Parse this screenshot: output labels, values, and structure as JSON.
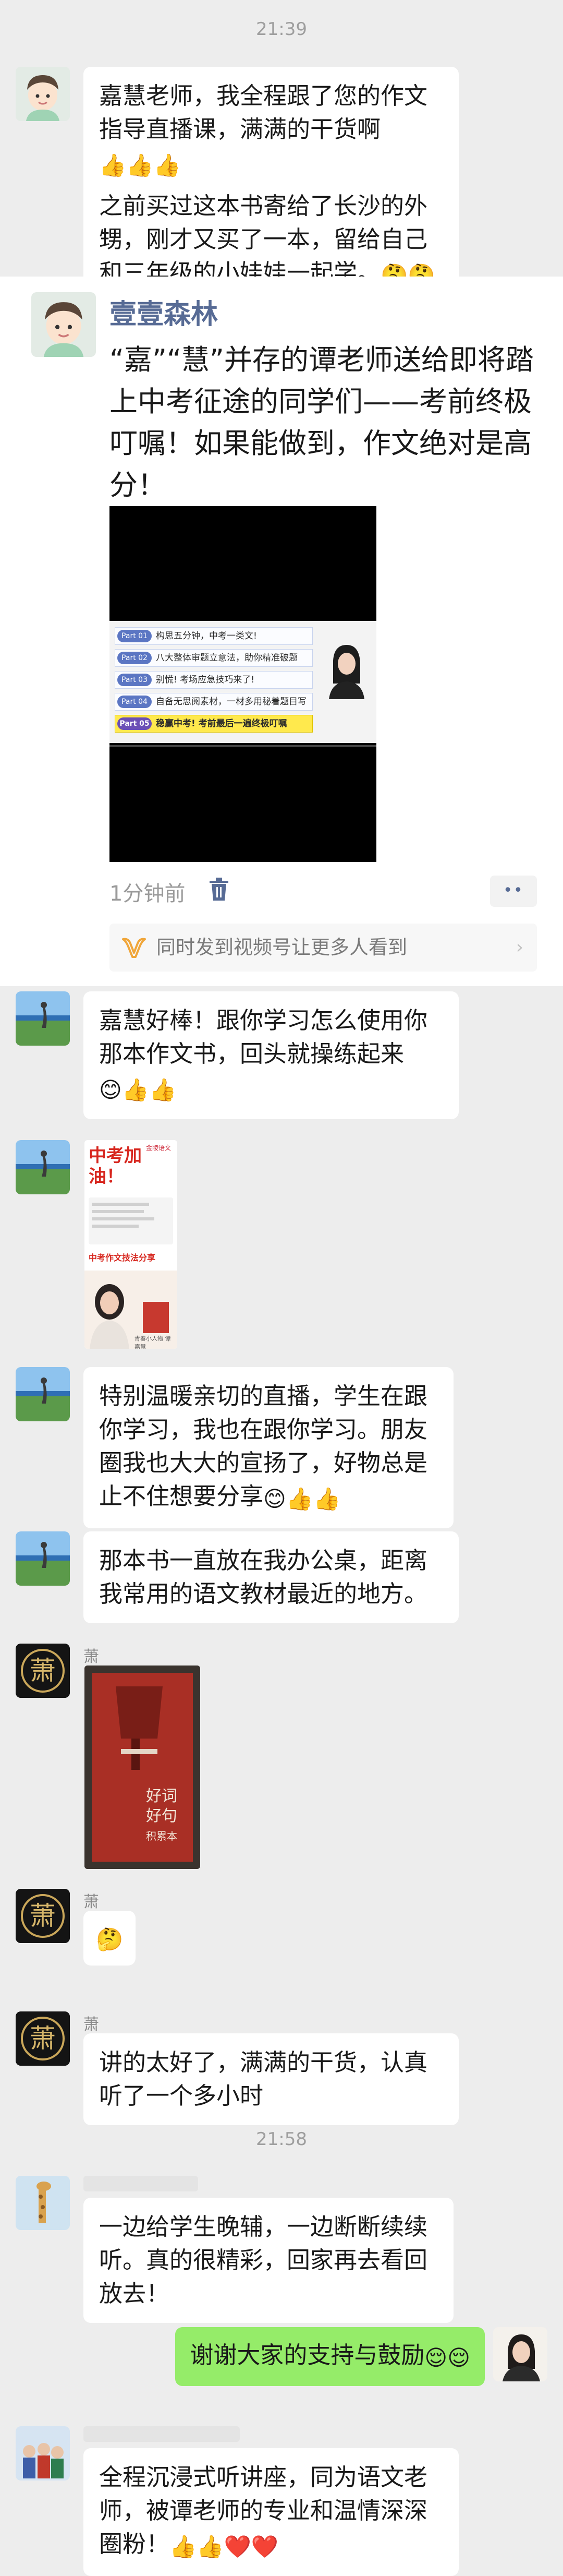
{
  "timestamps": [
    "21:39",
    "21:58"
  ],
  "messages": {
    "m1": {
      "p1": "嘉慧老师，我全程跟了您的作文指导直播课，满满的干货啊",
      "p1_emoji": "👍👍👍",
      "p2": "之前买过这本书寄给了长沙的外甥，刚才又买了一本，留给自己和三年级的小娃娃一起学。",
      "p2_emoji": "🤔🤔"
    },
    "moment": {
      "author": "壹壹森林",
      "text": "“嘉”“慧”并存的谭老师送给即将踏上中考征途的同学们——考前终极叮嘱！如果能做到，作文绝对是高分！",
      "video_items": [
        {
          "tag": "Part 01",
          "text": "构思五分钟，中考一类文!"
        },
        {
          "tag": "Part 02",
          "text": "八大整体审题立意法，助你精准破题"
        },
        {
          "tag": "Part 03",
          "text": "别慌! 考场应急技巧来了!"
        },
        {
          "tag": "Part 04",
          "text": "自备无思阅素材，一材多用秘着题目写"
        },
        {
          "tag": "Part 05",
          "text": "稳赢中考! 考前最后一遍终极叮嘱"
        }
      ],
      "time_ago": "1分钟前",
      "more": "••",
      "share_text": "同时发到视频号让更多人看到",
      "share_arrow": "›"
    },
    "m2": {
      "text": "嘉慧好棒！跟你学习怎么使用你那本作文书，回头就操练起来",
      "emoji": "😊👍👍"
    },
    "poster": {
      "title": "中考加油！",
      "brand": "金陵语文",
      "subtitle": "中考作文技法分享",
      "tagline": "青春小人物 谭嘉慧"
    },
    "m3": {
      "text": "特别温暖亲切的直播，学生在跟你学习，我也在跟你学习。朋友圈我也大大的宣扬了，好物总是止不住想要分享",
      "emoji": "😊👍👍"
    },
    "m4": {
      "text": "那本书一直放在我办公桌，距离我常用的语文教材最近的地方。"
    },
    "xiao": {
      "name": "萧",
      "avatar_char": "萧"
    },
    "book": {
      "title_line1": "好词",
      "title_line2": "好句",
      "title_line3": "积累本"
    },
    "m5": {
      "emoji": "🤔"
    },
    "m6": {
      "text": "讲的太好了，满满的干货，认真听了一个多小时"
    },
    "m7": {
      "text": "一边给学生晚辅，一边断断续续听。真的很精彩，回家再去看回放去！"
    },
    "m8": {
      "text": "谢谢大家的支持与鼓励",
      "emoji": "😌😌"
    },
    "m9": {
      "text": "全程沉浸式听讲座，同为语文老师，被谭老师的专业和温情深深圈粉！",
      "emoji": "👍👍❤️❤️"
    }
  },
  "colors": {
    "bubble_green": "#95ec69",
    "link_blue": "#576b95",
    "background": "#ededed"
  }
}
